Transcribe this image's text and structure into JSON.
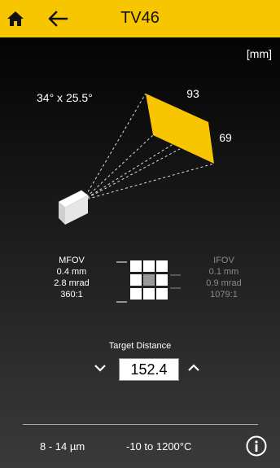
{
  "header": {
    "title": "TV46",
    "home_icon": "home-icon",
    "back_icon": "back-arrow-icon",
    "background": "#f7c600"
  },
  "unit_label": "[mm]",
  "field_of_view": {
    "angle_label": "34° x 25.5°",
    "width_label": "93",
    "height_label": "69",
    "accent_color": "#f7c600"
  },
  "mfov": {
    "title": "MFOV",
    "mm": "0.4 mm",
    "mrad": "2.8 mrad",
    "ratio": "360:1"
  },
  "ifov": {
    "title": "IFOV",
    "mm": "0.1 mm",
    "mrad": "0.9 mrad",
    "ratio": "1079:1"
  },
  "target": {
    "label": "Target Distance",
    "value": "152.4"
  },
  "footer": {
    "band": "8 - 14 µm",
    "range": "-10 to 1200°C",
    "info_icon": "info-icon"
  }
}
